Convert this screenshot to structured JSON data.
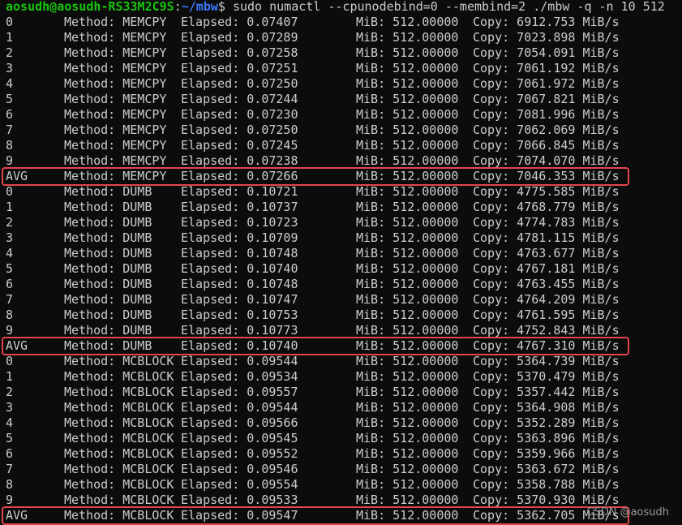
{
  "prompt": {
    "user_host": "aosudh@aosudh-RS33M2C9S",
    "sep": ":",
    "path": "~/mbw",
    "dollar": "$",
    "command": " sudo numactl --cpunodebind=0 --membind=2 ./mbw -q -n 10 512"
  },
  "rows": [
    {
      "idx": "0",
      "method": "Method: MEMCPY",
      "elapsed": "Elapsed: 0.07407",
      "mib": "MiB: 512.00000",
      "copy": "Copy: 6912.753 MiB/s"
    },
    {
      "idx": "1",
      "method": "Method: MEMCPY",
      "elapsed": "Elapsed: 0.07289",
      "mib": "MiB: 512.00000",
      "copy": "Copy: 7023.898 MiB/s"
    },
    {
      "idx": "2",
      "method": "Method: MEMCPY",
      "elapsed": "Elapsed: 0.07258",
      "mib": "MiB: 512.00000",
      "copy": "Copy: 7054.091 MiB/s"
    },
    {
      "idx": "3",
      "method": "Method: MEMCPY",
      "elapsed": "Elapsed: 0.07251",
      "mib": "MiB: 512.00000",
      "copy": "Copy: 7061.192 MiB/s"
    },
    {
      "idx": "4",
      "method": "Method: MEMCPY",
      "elapsed": "Elapsed: 0.07250",
      "mib": "MiB: 512.00000",
      "copy": "Copy: 7061.972 MiB/s"
    },
    {
      "idx": "5",
      "method": "Method: MEMCPY",
      "elapsed": "Elapsed: 0.07244",
      "mib": "MiB: 512.00000",
      "copy": "Copy: 7067.821 MiB/s"
    },
    {
      "idx": "6",
      "method": "Method: MEMCPY",
      "elapsed": "Elapsed: 0.07230",
      "mib": "MiB: 512.00000",
      "copy": "Copy: 7081.996 MiB/s"
    },
    {
      "idx": "7",
      "method": "Method: MEMCPY",
      "elapsed": "Elapsed: 0.07250",
      "mib": "MiB: 512.00000",
      "copy": "Copy: 7062.069 MiB/s"
    },
    {
      "idx": "8",
      "method": "Method: MEMCPY",
      "elapsed": "Elapsed: 0.07245",
      "mib": "MiB: 512.00000",
      "copy": "Copy: 7066.845 MiB/s"
    },
    {
      "idx": "9",
      "method": "Method: MEMCPY",
      "elapsed": "Elapsed: 0.07238",
      "mib": "MiB: 512.00000",
      "copy": "Copy: 7074.070 MiB/s"
    },
    {
      "idx": "AVG",
      "method": "Method: MEMCPY",
      "elapsed": "Elapsed: 0.07266",
      "mib": "MiB: 512.00000",
      "copy": "Copy: 7046.353 MiB/s",
      "avg": true
    },
    {
      "idx": "0",
      "method": "Method: DUMB",
      "elapsed": "Elapsed: 0.10721",
      "mib": "MiB: 512.00000",
      "copy": "Copy: 4775.585 MiB/s"
    },
    {
      "idx": "1",
      "method": "Method: DUMB",
      "elapsed": "Elapsed: 0.10737",
      "mib": "MiB: 512.00000",
      "copy": "Copy: 4768.779 MiB/s"
    },
    {
      "idx": "2",
      "method": "Method: DUMB",
      "elapsed": "Elapsed: 0.10723",
      "mib": "MiB: 512.00000",
      "copy": "Copy: 4774.783 MiB/s"
    },
    {
      "idx": "3",
      "method": "Method: DUMB",
      "elapsed": "Elapsed: 0.10709",
      "mib": "MiB: 512.00000",
      "copy": "Copy: 4781.115 MiB/s"
    },
    {
      "idx": "4",
      "method": "Method: DUMB",
      "elapsed": "Elapsed: 0.10748",
      "mib": "MiB: 512.00000",
      "copy": "Copy: 4763.677 MiB/s"
    },
    {
      "idx": "5",
      "method": "Method: DUMB",
      "elapsed": "Elapsed: 0.10740",
      "mib": "MiB: 512.00000",
      "copy": "Copy: 4767.181 MiB/s"
    },
    {
      "idx": "6",
      "method": "Method: DUMB",
      "elapsed": "Elapsed: 0.10748",
      "mib": "MiB: 512.00000",
      "copy": "Copy: 4763.455 MiB/s"
    },
    {
      "idx": "7",
      "method": "Method: DUMB",
      "elapsed": "Elapsed: 0.10747",
      "mib": "MiB: 512.00000",
      "copy": "Copy: 4764.209 MiB/s"
    },
    {
      "idx": "8",
      "method": "Method: DUMB",
      "elapsed": "Elapsed: 0.10753",
      "mib": "MiB: 512.00000",
      "copy": "Copy: 4761.595 MiB/s"
    },
    {
      "idx": "9",
      "method": "Method: DUMB",
      "elapsed": "Elapsed: 0.10773",
      "mib": "MiB: 512.00000",
      "copy": "Copy: 4752.843 MiB/s"
    },
    {
      "idx": "AVG",
      "method": "Method: DUMB",
      "elapsed": "Elapsed: 0.10740",
      "mib": "MiB: 512.00000",
      "copy": "Copy: 4767.310 MiB/s",
      "avg": true
    },
    {
      "idx": "0",
      "method": "Method: MCBLOCK",
      "elapsed": "Elapsed: 0.09544",
      "mib": "MiB: 512.00000",
      "copy": "Copy: 5364.739 MiB/s"
    },
    {
      "idx": "1",
      "method": "Method: MCBLOCK",
      "elapsed": "Elapsed: 0.09534",
      "mib": "MiB: 512.00000",
      "copy": "Copy: 5370.479 MiB/s"
    },
    {
      "idx": "2",
      "method": "Method: MCBLOCK",
      "elapsed": "Elapsed: 0.09557",
      "mib": "MiB: 512.00000",
      "copy": "Copy: 5357.442 MiB/s"
    },
    {
      "idx": "3",
      "method": "Method: MCBLOCK",
      "elapsed": "Elapsed: 0.09544",
      "mib": "MiB: 512.00000",
      "copy": "Copy: 5364.908 MiB/s"
    },
    {
      "idx": "4",
      "method": "Method: MCBLOCK",
      "elapsed": "Elapsed: 0.09566",
      "mib": "MiB: 512.00000",
      "copy": "Copy: 5352.289 MiB/s"
    },
    {
      "idx": "5",
      "method": "Method: MCBLOCK",
      "elapsed": "Elapsed: 0.09545",
      "mib": "MiB: 512.00000",
      "copy": "Copy: 5363.896 MiB/s"
    },
    {
      "idx": "6",
      "method": "Method: MCBLOCK",
      "elapsed": "Elapsed: 0.09552",
      "mib": "MiB: 512.00000",
      "copy": "Copy: 5359.966 MiB/s"
    },
    {
      "idx": "7",
      "method": "Method: MCBLOCK",
      "elapsed": "Elapsed: 0.09546",
      "mib": "MiB: 512.00000",
      "copy": "Copy: 5363.672 MiB/s"
    },
    {
      "idx": "8",
      "method": "Method: MCBLOCK",
      "elapsed": "Elapsed: 0.09554",
      "mib": "MiB: 512.00000",
      "copy": "Copy: 5358.788 MiB/s"
    },
    {
      "idx": "9",
      "method": "Method: MCBLOCK",
      "elapsed": "Elapsed: 0.09533",
      "mib": "MiB: 512.00000",
      "copy": "Copy: 5370.930 MiB/s"
    },
    {
      "idx": "AVG",
      "method": "Method: MCBLOCK",
      "elapsed": "Elapsed: 0.09547",
      "mib": "MiB: 512.00000",
      "copy": "Copy: 5362.705 MiB/s",
      "avg": true
    }
  ],
  "watermark": "CSDN @aosudh",
  "colors": {
    "background": "#0c0c0c",
    "text": "#cccccc",
    "user_host": "#16c60c",
    "path": "#3b78ff",
    "highlight_box": "#e2464d"
  }
}
